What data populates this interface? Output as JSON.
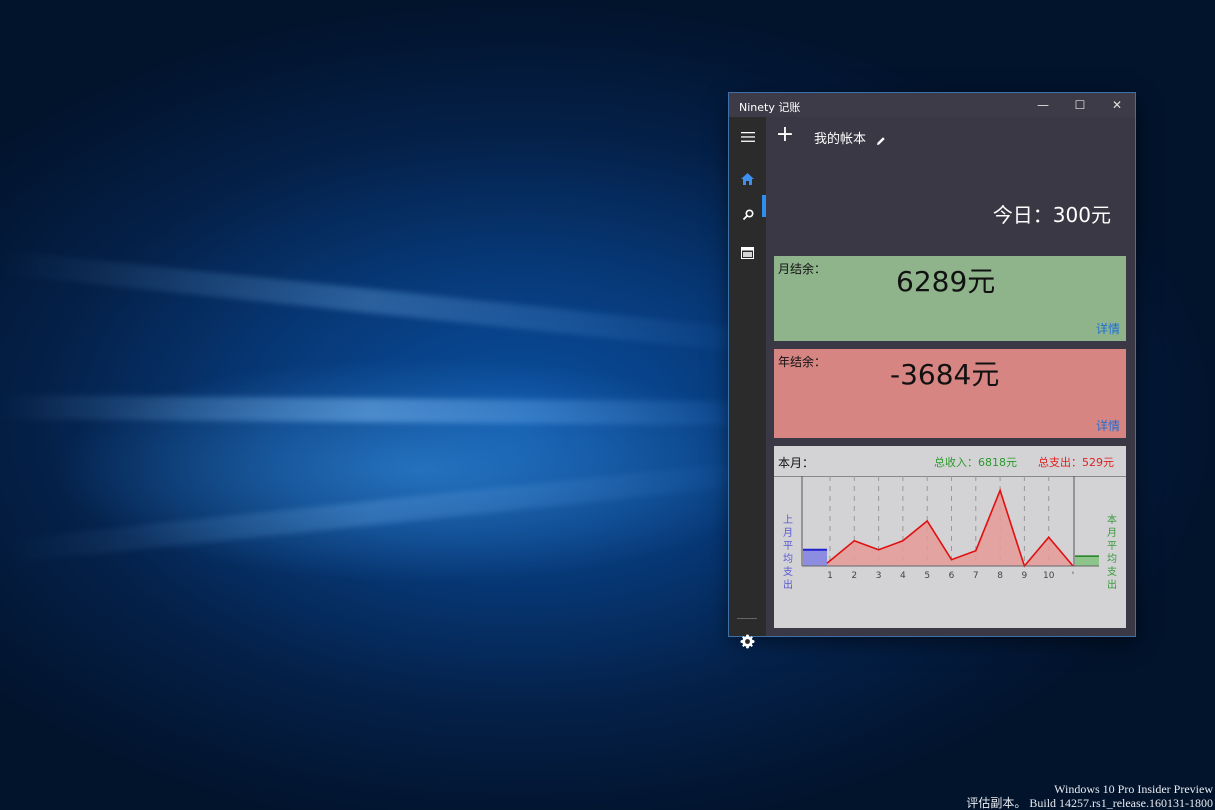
{
  "window": {
    "title": "Ninety 记账",
    "minimize_glyph": "—",
    "maximize_glyph": "☐",
    "close_glyph": "✕"
  },
  "nav": {
    "items": [
      {
        "icon": "hamburger-menu-icon"
      },
      {
        "icon": "home-icon",
        "active": true
      },
      {
        "icon": "search-icon"
      },
      {
        "icon": "calendar-icon"
      }
    ],
    "settings_icon": "gear-icon"
  },
  "header": {
    "add_glyph": "+",
    "book_name": "我的帐本",
    "today_text": "今日：300元"
  },
  "month_card": {
    "label": "月结余：",
    "amount": "6289元",
    "detail_link": "详情",
    "color": "#8fb48c"
  },
  "year_card": {
    "label": "年结余：",
    "amount": "-3684元",
    "detail_link": "详情",
    "color": "#d68582"
  },
  "this_month": {
    "label": "本月：",
    "income_text": "总收入：6818元",
    "expense_text": "总支出：529元",
    "left_label": "上月平均支出",
    "right_label": "本月平均支出"
  },
  "chart_data": {
    "type": "area",
    "categories": [
      "1",
      "2",
      "3",
      "4",
      "5",
      "6",
      "7",
      "8",
      "9",
      "10",
      "'"
    ],
    "values": [
      3,
      28,
      18,
      28,
      50,
      7,
      17,
      84,
      0,
      32,
      0
    ],
    "left_bar_value": 18,
    "right_bar_value": 11,
    "ylim": [
      0,
      100
    ],
    "colors": {
      "line": "#e01010",
      "fill": "#e59a98",
      "left_bar": "#8c8ce0",
      "left_bar_line": "#2020d0",
      "right_bar": "#8cc48c",
      "right_bar_line": "#208020"
    }
  },
  "watermark": {
    "line1": "Windows 10 Pro Insider Preview",
    "line2": "评估副本。 Build 14257.rs1_release.160131-1800"
  }
}
